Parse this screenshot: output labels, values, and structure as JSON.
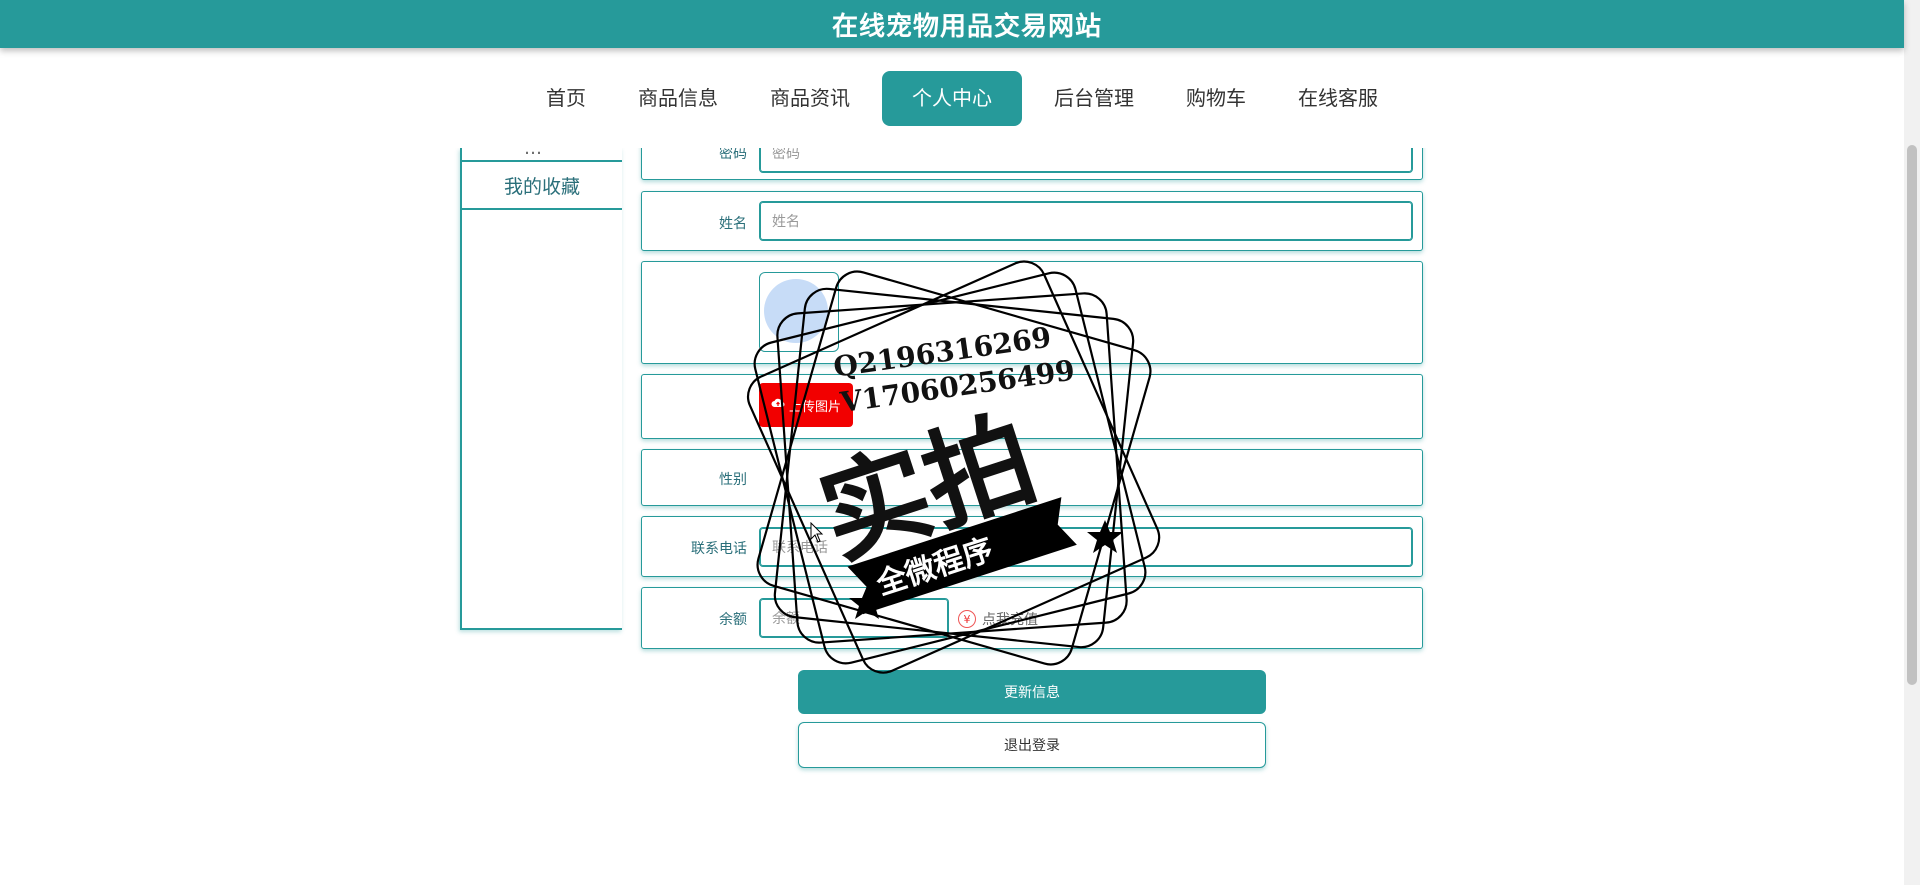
{
  "site": {
    "title": "在线宠物用品交易网站"
  },
  "nav": {
    "items": [
      {
        "label": "首页"
      },
      {
        "label": "商品信息"
      },
      {
        "label": "商品资讯"
      },
      {
        "label": "个人中心"
      },
      {
        "label": "后台管理"
      },
      {
        "label": "购物车"
      },
      {
        "label": "在线客服"
      }
    ],
    "active": "个人中心"
  },
  "sidebar": {
    "partial_item": "…",
    "items": [
      {
        "label": "我的收藏"
      }
    ]
  },
  "form": {
    "password": {
      "label": "密码",
      "placeholder": "密码"
    },
    "name": {
      "label": "姓名",
      "placeholder": "姓名"
    },
    "upload": {
      "label": "上传图片",
      "icon": "cloud-upload-icon"
    },
    "gender": {
      "label": "性别"
    },
    "phone": {
      "label": "联系电话",
      "placeholder": "联系电话"
    },
    "balance": {
      "label": "余额",
      "placeholder": "余额",
      "recharge_label": "点我充值",
      "recharge_icon": "yen-icon"
    }
  },
  "actions": {
    "update_label": "更新信息",
    "logout_label": "退出登录"
  },
  "watermark": {
    "line1": "Q2196316269",
    "line2": "V17060256499",
    "big_text": "实拍",
    "ribbon_text": "全微程序"
  },
  "colors": {
    "accent": "#269a9a",
    "upload": "#f20000"
  }
}
